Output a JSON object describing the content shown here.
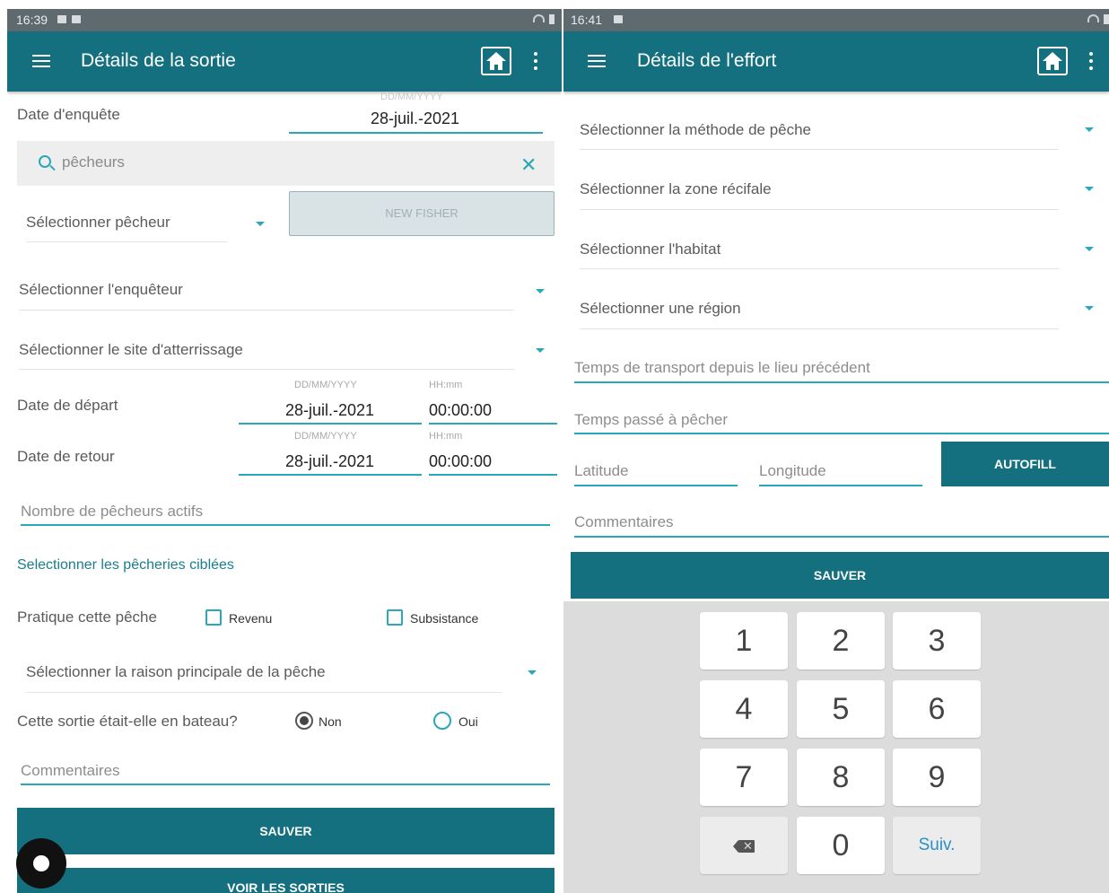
{
  "left": {
    "status": {
      "time": "16:39"
    },
    "appbar": {
      "title": "Détails de la sortie"
    },
    "date_enquete": {
      "label": "Date d'enquête",
      "hint": "DD/MM/YYYY",
      "value": "28-juil.-2021"
    },
    "search": {
      "placeholder": "pêcheurs"
    },
    "select_pecheur": "Sélectionner pêcheur",
    "new_fisher": "NEW FISHER",
    "select_enqueteur": "Sélectionner l'enquêteur",
    "select_site": "Sélectionner le site d'atterrissage",
    "date_depart": {
      "label": "Date de départ",
      "date_hint": "DD/MM/YYYY",
      "time_hint": "HH:mm",
      "date": "28-juil.-2021",
      "time": "00:00:00"
    },
    "date_retour": {
      "label": "Date de retour",
      "date_hint": "DD/MM/YYYY",
      "time_hint": "HH:mm",
      "date": "28-juil.-2021",
      "time": "00:00:00"
    },
    "nombre_pecheurs": "Nombre de pêcheurs actifs",
    "pecheries_link": "Selectionner les pêcheries ciblées",
    "pratique": {
      "label": "Pratique cette pêche",
      "opt1": "Revenu",
      "opt2": "Subsistance"
    },
    "raison": "Sélectionner la raison principale de la pêche",
    "bateau": {
      "label": "Cette sortie était-elle en bateau?",
      "opt_non": "Non",
      "opt_oui": "Oui",
      "selected": "Non"
    },
    "commentaires": "Commentaires",
    "save": "SAUVER",
    "voir": "VOIR LES SORTIES"
  },
  "right": {
    "status": {
      "time": "16:41"
    },
    "appbar": {
      "title": "Détails de l'effort"
    },
    "select_methode": "Sélectionner la méthode de pêche",
    "select_zone": "Sélectionner la zone récifale",
    "select_habitat": "Sélectionner l'habitat",
    "select_region": "Sélectionner une région",
    "temps_transport": "Temps de transport depuis le lieu précédent",
    "temps_peche": "Temps passé à pêcher",
    "latitude": "Latitude",
    "longitude": "Longitude",
    "autofill": "AUTOFILL",
    "commentaires": "Commentaires",
    "save": "SAUVER",
    "keypad": [
      "1",
      "2",
      "3",
      "4",
      "5",
      "6",
      "7",
      "8",
      "9",
      "0"
    ],
    "keypad_next": "Suiv."
  },
  "colors": {
    "primary": "#14707e",
    "accent": "#2aa7b9",
    "statusbar": "#5f6a6e"
  }
}
